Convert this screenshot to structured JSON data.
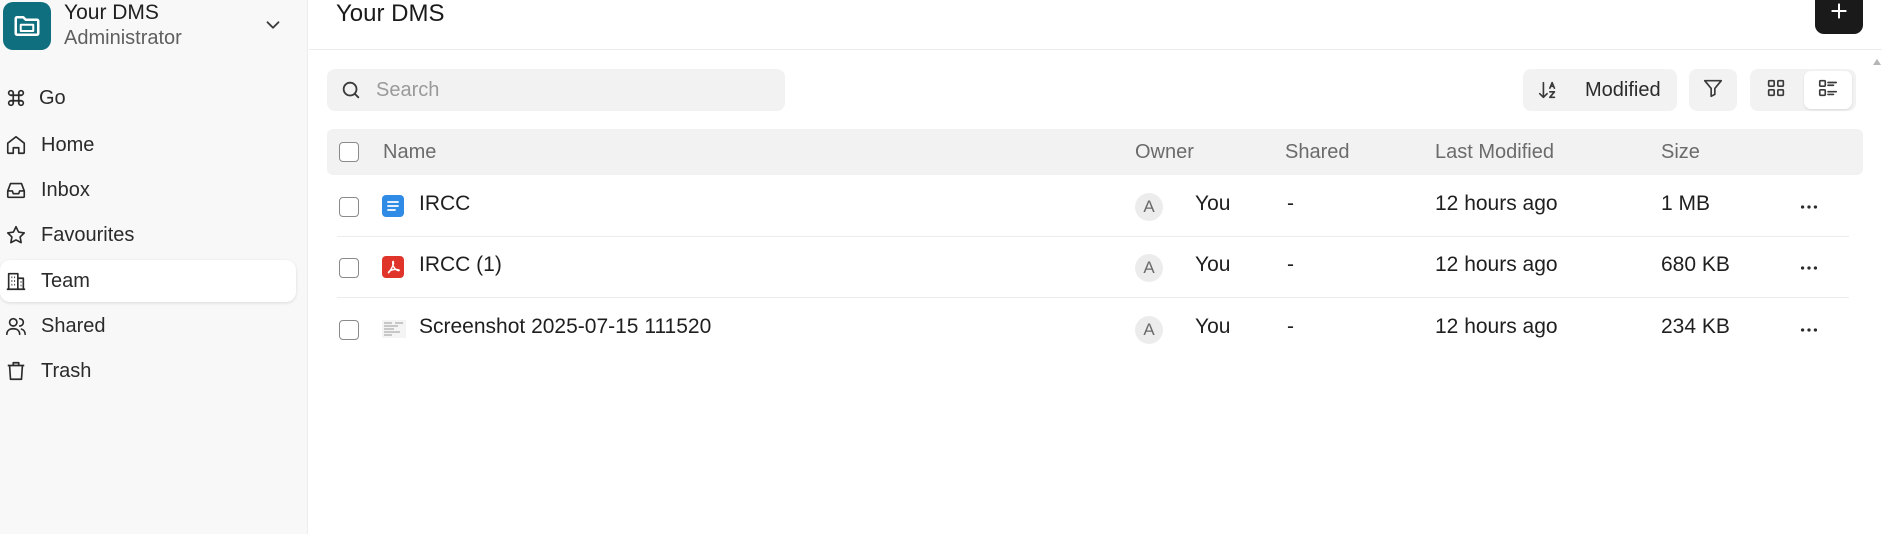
{
  "workspace": {
    "name": "Your DMS",
    "role": "Administrator",
    "logo_color": "#0f6f7f"
  },
  "sidebar": {
    "items": [
      {
        "label": "Go",
        "icon": "command-icon"
      },
      {
        "label": "Home",
        "icon": "home-icon"
      },
      {
        "label": "Inbox",
        "icon": "inbox-icon"
      },
      {
        "label": "Favourites",
        "icon": "star-icon"
      },
      {
        "label": "Team",
        "icon": "building-icon",
        "active": true
      },
      {
        "label": "Shared",
        "icon": "users-icon"
      },
      {
        "label": "Trash",
        "icon": "trash-icon"
      }
    ]
  },
  "header": {
    "title": "Your DMS",
    "add_icon": "plus-icon"
  },
  "toolbar": {
    "search_placeholder": "Search",
    "search_value": "",
    "sort_label": "Modified",
    "view_mode": "list"
  },
  "table": {
    "columns": [
      "Name",
      "Owner",
      "Shared",
      "Last Modified",
      "Size"
    ],
    "rows": [
      {
        "name": "IRCC",
        "type": "document",
        "owner_initial": "A",
        "owner": "You",
        "shared": "-",
        "modified": "12 hours ago",
        "size": "1 MB"
      },
      {
        "name": "IRCC (1)",
        "type": "pdf",
        "owner_initial": "A",
        "owner": "You",
        "shared": "-",
        "modified": "12 hours ago",
        "size": "680 KB"
      },
      {
        "name": "Screenshot 2025-07-15 111520",
        "type": "image",
        "owner_initial": "A",
        "owner": "You",
        "shared": "-",
        "modified": "12 hours ago",
        "size": "234 KB"
      }
    ]
  },
  "colors": {
    "doc_icon": "#2f8be6",
    "pdf_icon": "#e0342b",
    "active_bg": "#ffffff",
    "primary_button": "#1a1a1a"
  }
}
